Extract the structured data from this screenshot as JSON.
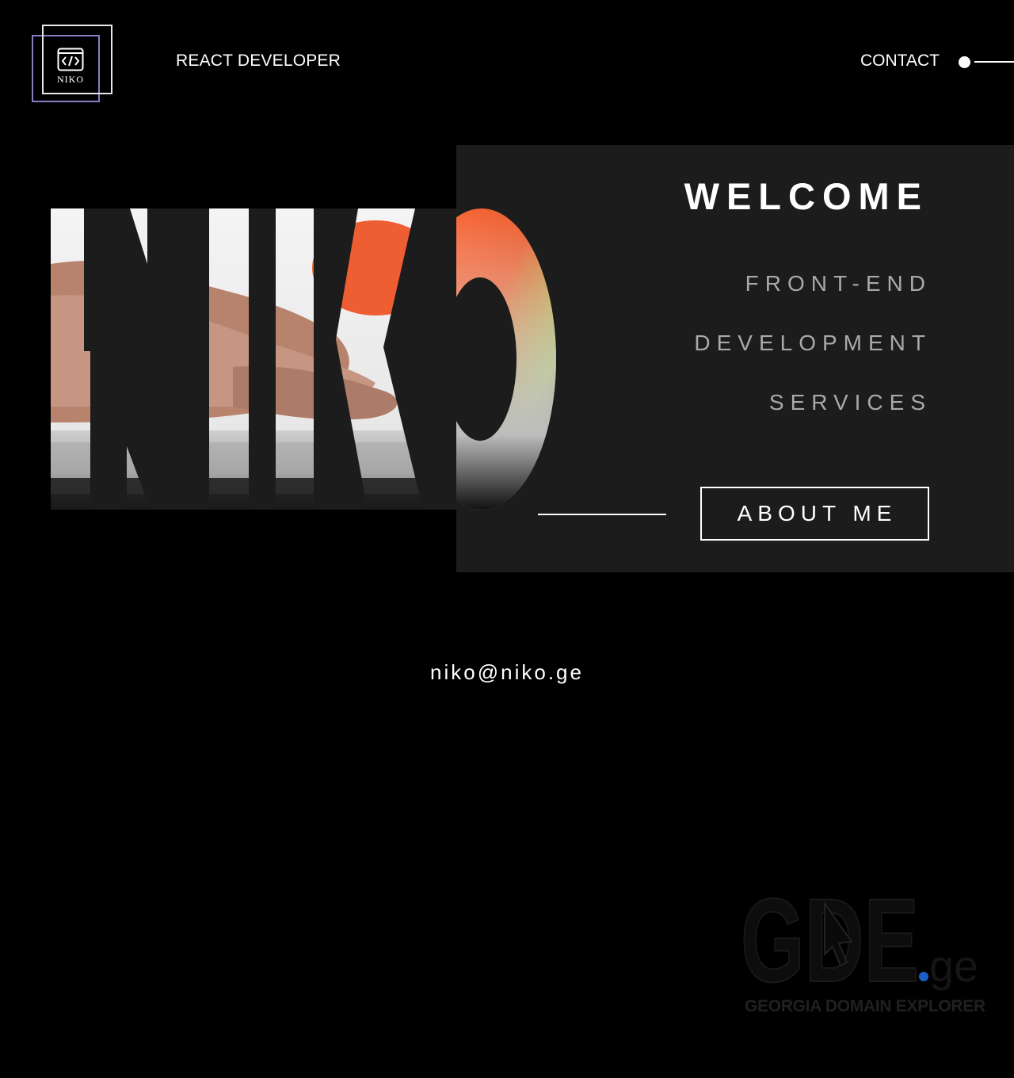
{
  "header": {
    "logo_text": "NIKO",
    "logo_icon": "code-window-icon",
    "role": "REACT DEVELOPER",
    "contact_label": "CONTACT"
  },
  "hero": {
    "big_word": "NIKO",
    "welcome": "WELCOME",
    "services": [
      "FRONT-END",
      "DEVELOPMENT",
      "SERVICES"
    ],
    "about_label": "ABOUT ME"
  },
  "footer": {
    "email": "niko@niko.ge"
  },
  "watermark": {
    "logo": "GDE.ge",
    "subtitle": "GEORGIA DOMAIN EXPLORER"
  },
  "colors": {
    "background": "#000000",
    "panel": "#1c1c1c",
    "logo_accent": "#8b7bc4",
    "muted_text": "#a9a9a9",
    "watermark_dot": "#1a5fc4"
  }
}
